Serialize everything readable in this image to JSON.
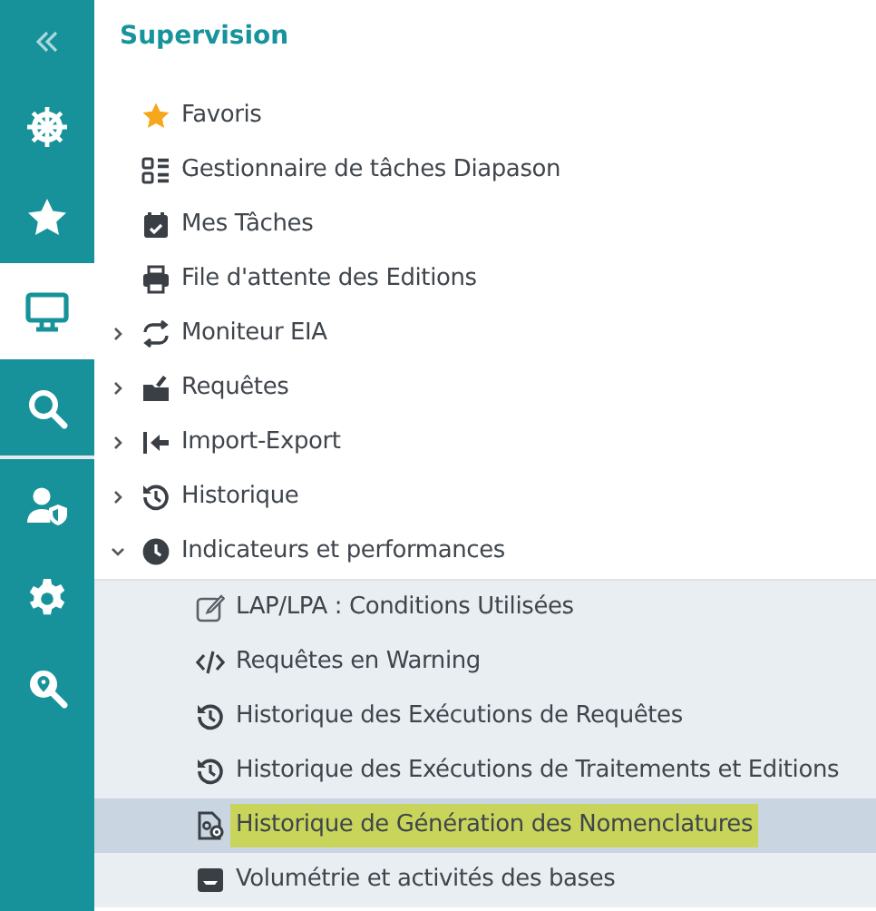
{
  "rail": {
    "items": [
      {
        "selected": false
      },
      {
        "selected": false
      },
      {
        "selected": true
      },
      {
        "selected": false
      },
      {
        "selected": false
      },
      {
        "selected": false
      },
      {
        "selected": false
      }
    ]
  },
  "panel": {
    "title": "Supervision",
    "tree": [
      {
        "label": "Favoris",
        "selected": false
      },
      {
        "label": "Gestionnaire de tâches Diapason",
        "selected": false
      },
      {
        "label": "Mes Tâches",
        "selected": false
      },
      {
        "label": "File d'attente des Editions",
        "selected": false
      },
      {
        "label": "Moniteur EIA",
        "selected": false,
        "expanded": false
      },
      {
        "label": "Requêtes",
        "selected": false,
        "expanded": false
      },
      {
        "label": "Import-Export",
        "selected": false,
        "expanded": false
      },
      {
        "label": "Historique",
        "selected": false,
        "expanded": false
      },
      {
        "label": "Indicateurs et performances",
        "selected": false,
        "expanded": true,
        "children": [
          {
            "label": "LAP/LPA : Conditions Utilisées",
            "selected": false
          },
          {
            "label": "Requêtes en Warning",
            "selected": false
          },
          {
            "label": "Historique des Exécutions de Requêtes",
            "selected": false
          },
          {
            "label": "Historique des Exécutions de Traitements et Editions",
            "selected": false
          },
          {
            "label": "Historique de Génération des Nomenclatures",
            "selected": true
          },
          {
            "label": "Volumétrie et activités des bases",
            "selected": false
          }
        ]
      }
    ]
  }
}
